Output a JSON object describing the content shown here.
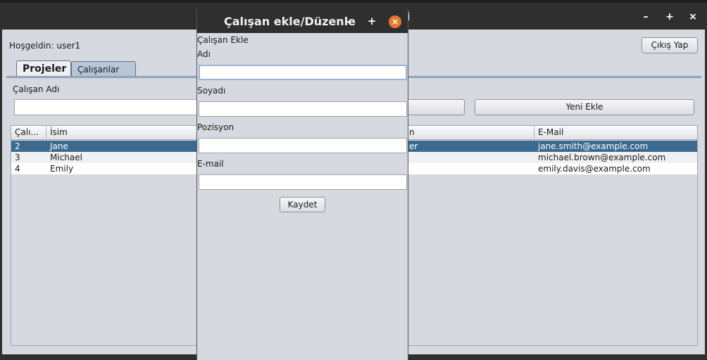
{
  "main_window": {
    "title_fragment": "i",
    "controls": {
      "minimize": "–",
      "maximize": "+",
      "close": "×"
    },
    "welcome_text": "Hoşgeldin: user1",
    "logout_label": "Çıkış Yap",
    "tabs": [
      {
        "label": "Projeler",
        "selected": false
      },
      {
        "label": "Çalışanlar",
        "selected": true
      }
    ],
    "filter_label": "Çalışan Adı",
    "filter_value": "",
    "new_button_label": "Yeni Ekle",
    "table": {
      "columns": [
        "Çalı...",
        "İsim",
        "n",
        "E-Mail"
      ],
      "rows": [
        {
          "id": "2",
          "name": "Jane",
          "middle": "er",
          "email": "jane.smith@example.com",
          "selected": true
        },
        {
          "id": "3",
          "name": "Michael",
          "middle": "",
          "email": "michael.brown@example.com",
          "selected": false
        },
        {
          "id": "4",
          "name": "Emily",
          "middle": "",
          "email": "emily.davis@example.com",
          "selected": false
        }
      ]
    }
  },
  "dialog": {
    "title": "Çalışan ekle/Düzenle",
    "controls": {
      "minimize": "–",
      "maximize": "+",
      "close": "×"
    },
    "heading": "Çalışan Ekle",
    "fields": [
      {
        "label": "Adı",
        "value": ""
      },
      {
        "label": "Soyadı",
        "value": ""
      },
      {
        "label": "Pozisyon",
        "value": ""
      },
      {
        "label": "E-mail",
        "value": ""
      }
    ],
    "save_label": "Kaydet"
  },
  "colors": {
    "selection": "#3b6a8e",
    "close_button": "#e8772e",
    "titlebar": "#2f2f2f",
    "panel": "#d6d9df"
  }
}
